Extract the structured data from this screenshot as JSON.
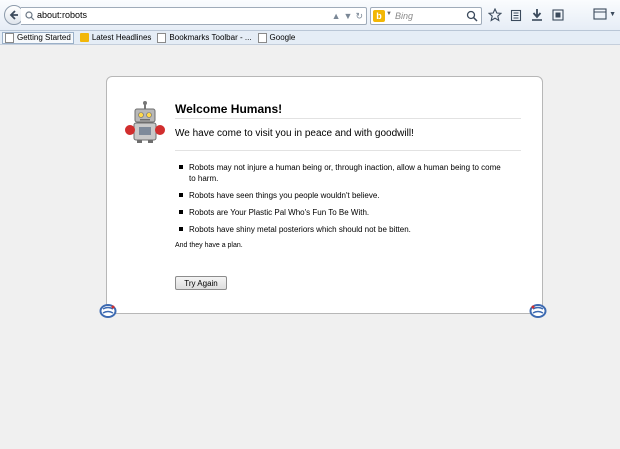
{
  "browser": {
    "url": "about:robots",
    "search_placeholder": "Bing",
    "search_engine_icon": "bing-logo",
    "search_engine_letter": "b",
    "icons": [
      "back-arrow-icon",
      "lock-icon",
      "dropdown-icon",
      "reload-icon",
      "search-icon",
      "star-icon",
      "bookmarks-list-icon",
      "download-icon",
      "home-icon",
      "menu-icon"
    ]
  },
  "bookmarks": [
    {
      "label": "Getting Started",
      "icon": "page-icon"
    },
    {
      "label": "Latest Headlines",
      "icon": "rss-icon"
    },
    {
      "label": "Bookmarks Toolbar - ...",
      "icon": "page-icon"
    },
    {
      "label": "Google",
      "icon": "page-icon"
    }
  ],
  "page": {
    "title": "Welcome Humans!",
    "subtitle": "We have come to visit you in peace and with goodwill!",
    "laws": [
      "Robots may not injure a human being or, through inaction, allow a human being to come to harm.",
      "Robots have seen things you people wouldn't believe.",
      "Robots are Your Plastic Pal Who's Fun To Be With.",
      "Robots have shiny metal posteriors which should not be bitten."
    ],
    "plan": "And they have a plan.",
    "button_label": "Try Again"
  },
  "colors": {
    "accent": "#3d6ab1",
    "content_bg": "#f0f0f0",
    "card_bg": "#ffffff"
  }
}
